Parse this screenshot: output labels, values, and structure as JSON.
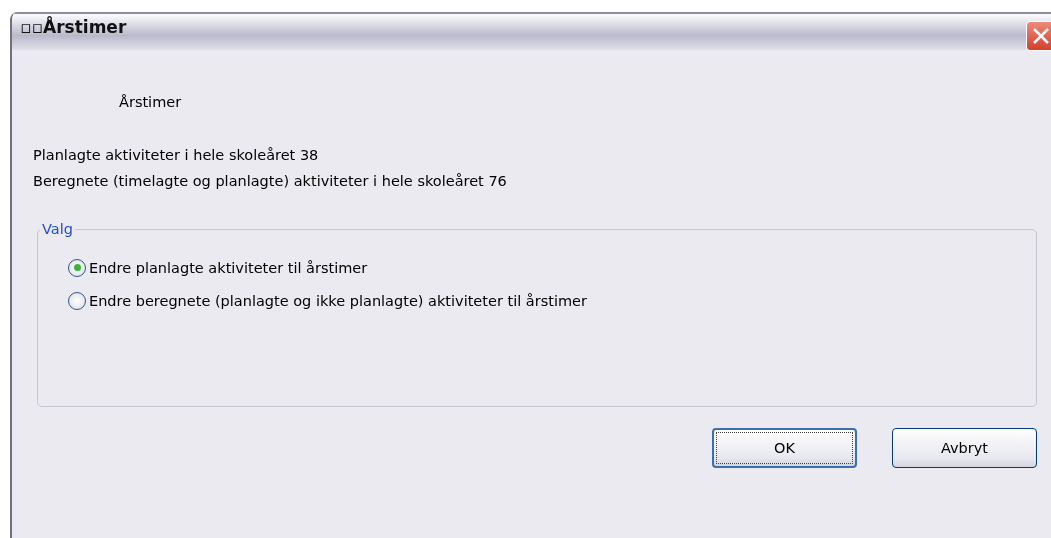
{
  "window": {
    "title": "▫▫Årstimer"
  },
  "heading": "Årstimer",
  "info_lines": [
    "Planlagte aktiviteter i hele skoleåret 38",
    "Beregnete (timelagte og planlagte) aktiviteter i hele skoleåret 76"
  ],
  "group": {
    "legend": "Valg",
    "options": [
      {
        "label": "Endre planlagte aktiviteter til årstimer",
        "selected": true
      },
      {
        "label": "Endre beregnete (planlagte og ikke planlagte) aktiviteter til årstimer",
        "selected": false
      }
    ]
  },
  "buttons": [
    {
      "label": "OK",
      "default": true
    },
    {
      "label": "Avbryt",
      "default": false
    }
  ]
}
